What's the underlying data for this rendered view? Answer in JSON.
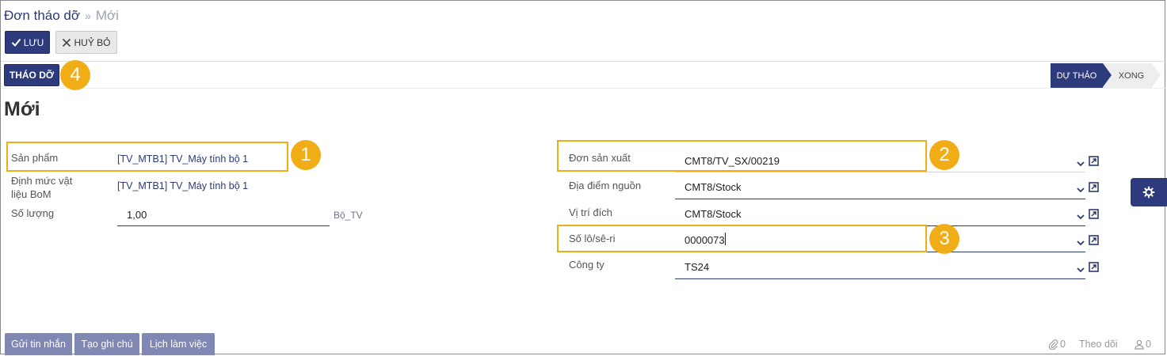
{
  "breadcrumb": {
    "parent": "Đơn tháo dỡ",
    "separator": "»",
    "current": "Mới"
  },
  "toolbar": {
    "save_label": "LƯU",
    "discard_label": "HUỶ BỎ"
  },
  "action": {
    "unbuild_label": "THÁO DỠ"
  },
  "status_bar": {
    "active": "DỰ THẢO",
    "inactive": "XONG"
  },
  "record_title": "Mới",
  "form_left": {
    "product_label": "Sản phẩm",
    "product_value": "[TV_MTB1] TV_Máy tính bộ 1",
    "bom_label_line1": "Định mức vật",
    "bom_label_line2": "liệu BoM",
    "bom_value": "[TV_MTB1] TV_Máy tính bộ 1",
    "qty_label": "Số lượng",
    "qty_value": "1,00",
    "qty_unit": "Bộ_TV"
  },
  "form_right": {
    "mo_label": "Đơn sản xuất",
    "mo_value": "CMT8/TV_SX/00219",
    "src_label": "Địa điểm nguồn",
    "src_value": "CMT8/Stock",
    "dest_label": "Vị trí đích",
    "dest_value": "CMT8/Stock",
    "lot_label": "Số lô/sê-ri",
    "lot_value": "0000073",
    "company_label": "Công ty",
    "company_value": "TS24"
  },
  "callouts": [
    "1",
    "2",
    "3",
    "4"
  ],
  "chatter": {
    "send_message": "Gửi tin nhắn",
    "log_note": "Tạo ghi chú",
    "schedule": "Lịch làm việc"
  },
  "footer": {
    "attachments": "0",
    "follow": "Theo dõi",
    "followers": "0"
  },
  "colors": {
    "primary": "#2d3a7c",
    "callout": "#f1ad15",
    "chatter": "#8087b3"
  },
  "icons": [
    "check-icon",
    "close-icon",
    "chevron-down-icon",
    "external-link-icon",
    "gear-icon",
    "paperclip-icon",
    "user-icon"
  ]
}
